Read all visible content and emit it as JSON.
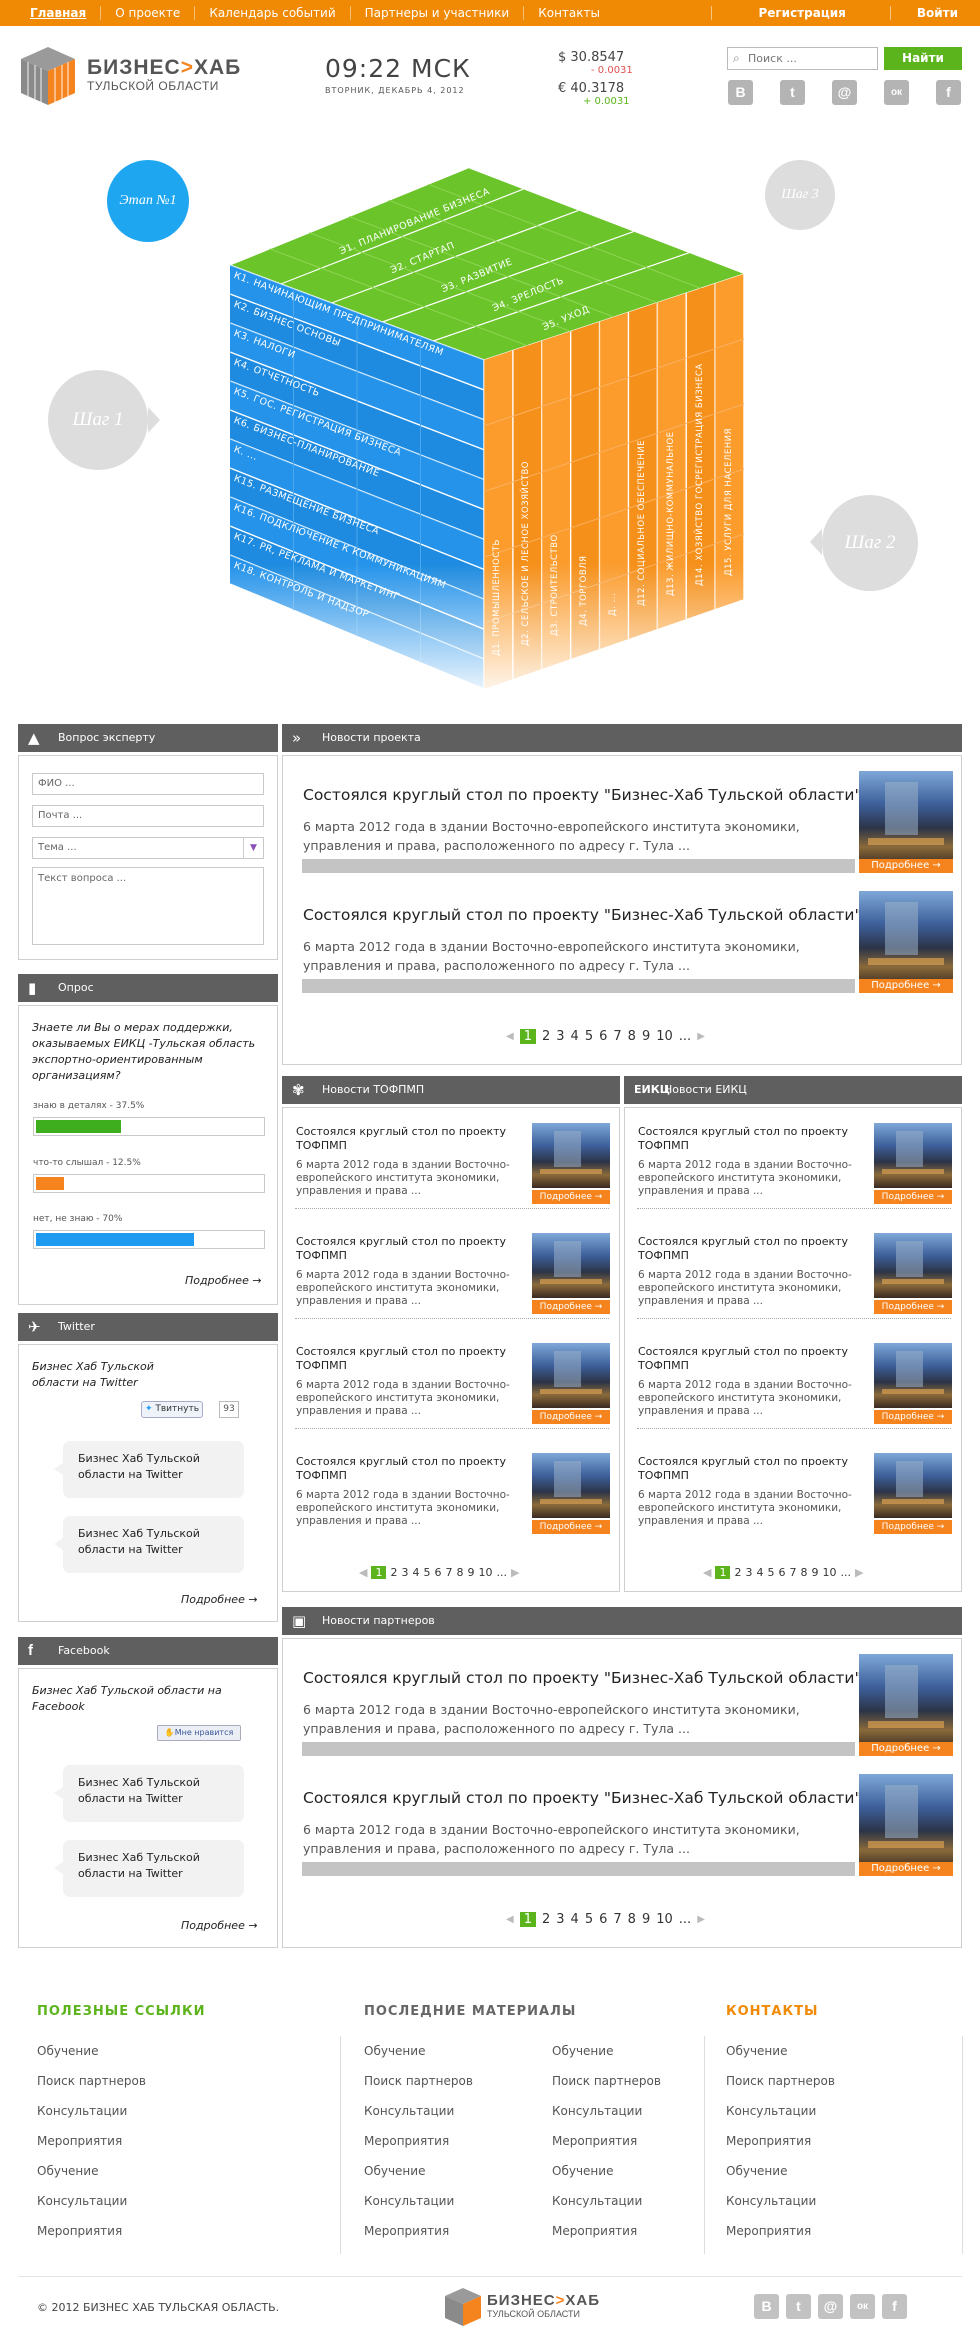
{
  "nav": {
    "items": [
      "Главная",
      "О проекте",
      "Календарь событий",
      "Партнеры и участники",
      "Контакты"
    ],
    "register": "Регистрация",
    "login": "Войти"
  },
  "header": {
    "brand": "БИЗНЕС",
    "brand_mid": "Х",
    "brand_end": "АБ",
    "brand_sub": "ТУЛЬСКОЙ ОБЛАСТИ",
    "time": "09:22 МСК",
    "date": "ВТОРНИК, ДЕКАБРЬ 4, 2012",
    "usd": "$ 30.8547",
    "usd_delta": "- 0.0031",
    "eur": "€ 40.3178",
    "eur_delta": "+ 0.0031",
    "search_placeholder": "Поиск ...",
    "search_button": "Найти",
    "social": [
      "В",
      "t",
      "@",
      "ок",
      "f"
    ]
  },
  "hero": {
    "bubbles": {
      "stage1": "Этап №1",
      "step3": "Шаг 3",
      "step1": "Шаг 1",
      "step2": "Шаг 2"
    },
    "top_rows": [
      "Э1. ПЛАНИРОВАНИЕ БИЗНЕСА",
      "Э2. СТАРТАП",
      "Э3. РАЗВИТИЕ",
      "Э4. ЗРЕЛОСТЬ",
      "Э5. УХОД"
    ],
    "left_rows": [
      "К1. НАЧИНАЮЩИМ ПРЕДПРИНИМАТЕЛЯМ",
      "К2. БИЗНЕС ОСНОВЫ",
      "К3. НАЛОГИ",
      "К4. ОТЧЕТНОСТЬ",
      "К5. ГОС. РЕГИСТРАЦИЯ БИЗНЕСА",
      "К6. БИЗНЕС-ПЛАНИРОВАНИЕ",
      "К. ...",
      "К15. РАЗМЕЩЕНИЕ БИЗНЕСА",
      "К16. ПОДКЛЮЧЕНИЕ К КОММУНИКАЦИЯМ",
      "К17. PR, РЕКЛАМА И МАРКЕТИНГ",
      "К18. КОНТРОЛЬ И НАДЗОР"
    ],
    "right_cols": [
      "Д1. ПРОМЫШЛЕННОСТЬ",
      "Д2. СЕЛЬСКОЕ И ЛЕСНОЕ ХОЗЯЙСТВО",
      "Д3. СТРОИТЕЛЬСТВО",
      "Д4. ТОРГОВЛЯ",
      "Д. ...",
      "Д12. СОЦИАЛЬНОЕ ОБЕСПЕЧЕНИЕ",
      "Д13. ЖИЛИЩНО-КОММУНАЛЬНОЕ",
      "Д14. ХОЗЯЙСТВО ГОСРЕГИСТРАЦИЯ БИЗНЕСА",
      "Д15. УСЛУГИ ДЛЯ НАСЕЛЕНИЯ"
    ]
  },
  "expert": {
    "title": "Вопрос эксперту",
    "fio": "ФИО ...",
    "mail": "Почта ...",
    "topic": "Тема ...",
    "question": "Текст вопроса ..."
  },
  "poll": {
    "title": "Опрос",
    "question": "Знаете ли Вы о мерах поддержки, оказываемых ЕИКЦ -Тульская область экспортно-ориентированным организациям?",
    "options": [
      {
        "label": "знаю в деталях - 37.5%",
        "value": 37.5,
        "color": "#3fae1e"
      },
      {
        "label": "что-то слышал - 12.5%",
        "value": 12.5,
        "color": "#f5841f"
      },
      {
        "label": "нет, не знаю - 70%",
        "value": 70,
        "color": "#1e9bf0"
      }
    ],
    "more": "Подробнее →"
  },
  "twitter": {
    "title": "Twitter",
    "intro": "Бизнес Хаб Тульской области на Twitter",
    "btn": "Твитнуть",
    "count": "93",
    "msgs": [
      "Бизнес Хаб Тульской области на Twitter",
      "Бизнес Хаб Тульской области на Twitter"
    ],
    "more": "Подробнее →"
  },
  "facebook": {
    "title": "Facebook",
    "intro": "Бизнес Хаб Тульской области на Facebook",
    "btn": "Мне нравится",
    "msgs": [
      "Бизнес Хаб Тульской области на Twitter",
      "Бизнес Хаб Тульской области на Twitter"
    ],
    "more": "Подробнее →"
  },
  "news_project": {
    "title": "Новости проекта",
    "items": [
      {
        "title": "Состоялся круглый стол по проекту \"Бизнес-Хаб Тульской области\"",
        "text": "6 марта 2012 года в здании Восточно-европейского института экономики, управления и права, расположенного по адресу г. Тула ...",
        "more": "Подробнее →"
      },
      {
        "title": "Состоялся круглый стол по проекту \"Бизнес-Хаб Тульской области\"",
        "text": "6 марта 2012 года в здании Восточно-европейского института экономики, управления и права, расположенного по адресу г. Тула ...",
        "more": "Подробнее →"
      }
    ],
    "pages": [
      "1",
      "2",
      "3",
      "4",
      "5",
      "6",
      "7",
      "8",
      "9",
      "10",
      "..."
    ]
  },
  "news_tofpmp": {
    "title": "Новости ТОФПМП",
    "items": [
      {
        "title": "Состоялся круглый стол по проекту ТОФПМП",
        "text": "6 марта 2012 года в здании Восточно-европейского института экономики, управления и права ...",
        "more": "Подробнее →"
      },
      {
        "title": "Состоялся круглый стол по проекту ТОФПМП",
        "text": "6 марта 2012 года в здании Восточно-европейского института экономики, управления и права ...",
        "more": "Подробнее →"
      },
      {
        "title": "Состоялся круглый стол по проекту ТОФПМП",
        "text": "6 марта 2012 года в здании Восточно-европейского института экономики, управления и права ...",
        "more": "Подробнее →"
      },
      {
        "title": "Состоялся круглый стол по проекту ТОФПМП",
        "text": "6 марта 2012 года в здании Восточно-европейского института экономики, управления и права ...",
        "more": "Подробнее →"
      }
    ],
    "pages": [
      "1",
      "2",
      "3",
      "4",
      "5",
      "6",
      "7",
      "8",
      "9",
      "10",
      "..."
    ]
  },
  "news_eikc": {
    "title": "Новости ЕИКЦ",
    "icon_label": "ЕИКЦ",
    "items": [
      {
        "title": "Состоялся круглый стол по проекту ТОФПМП",
        "text": "6 марта 2012 года в здании Восточно-европейского института экономики, управления и права ...",
        "more": "Подробнее →"
      },
      {
        "title": "Состоялся круглый стол по проекту ТОФПМП",
        "text": "6 марта 2012 года в здании Восточно-европейского института экономики, управления и права ...",
        "more": "Подробнее →"
      },
      {
        "title": "Состоялся круглый стол по проекту ТОФПМП",
        "text": "6 марта 2012 года в здании Восточно-европейского института экономики, управления и права ...",
        "more": "Подробнее →"
      },
      {
        "title": "Состоялся круглый стол по проекту ТОФПМП",
        "text": "6 марта 2012 года в здании Восточно-европейского института экономики, управления и права ...",
        "more": "Подробнее →"
      }
    ],
    "pages": [
      "1",
      "2",
      "3",
      "4",
      "5",
      "6",
      "7",
      "8",
      "9",
      "10",
      "..."
    ]
  },
  "news_partners": {
    "title": "Новости партнеров",
    "items": [
      {
        "title": "Состоялся круглый стол по проекту \"Бизнес-Хаб Тульской области\"",
        "text": "6 марта 2012 года в здании Восточно-европейского института экономики, управления и права, расположенного по адресу г. Тула ...",
        "more": "Подробнее →"
      },
      {
        "title": "Состоялся круглый стол по проекту \"Бизнес-Хаб Тульской области\"",
        "text": "6 марта 2012 года в здании Восточно-европейского института экономики, управления и права, расположенного по адресу г. Тула ...",
        "more": "Подробнее →"
      }
    ],
    "pages": [
      "1",
      "2",
      "3",
      "4",
      "5",
      "6",
      "7",
      "8",
      "9",
      "10",
      "..."
    ]
  },
  "footer": {
    "useful_title": "ПОЛЕЗНЫЕ ССЫЛКИ",
    "useful": [
      "Обучение",
      "Поиск партнеров",
      "Консультации",
      "Мероприятия",
      "Обучение",
      "Консультации",
      "Мероприятия"
    ],
    "latest_title": "ПОСЛЕДНИЕ МАТЕРИАЛЫ",
    "latest1": [
      "Обучение",
      "Поиск партнеров",
      "Консультации",
      "Мероприятия",
      "Обучение",
      "Консультации",
      "Мероприятия"
    ],
    "latest2": [
      "Обучение",
      "Поиск партнеров",
      "Консультации",
      "Мероприятия",
      "Обучение",
      "Консультации",
      "Мероприятия"
    ],
    "contacts_title": "КОНТАКТЫ",
    "contacts": [
      "Обучение",
      "Поиск партнеров",
      "Консультации",
      "Мероприятия",
      "Обучение",
      "Консультации",
      "Мероприятия"
    ],
    "copyright": "© 2012 БИЗНЕС ХАБ ТУЛЬСКАЯ ОБЛАСТЬ."
  },
  "colors": {
    "orange": "#f08a05",
    "green": "#5cb41c",
    "blue": "#1e8be0",
    "dark": "#5f5f5f"
  }
}
